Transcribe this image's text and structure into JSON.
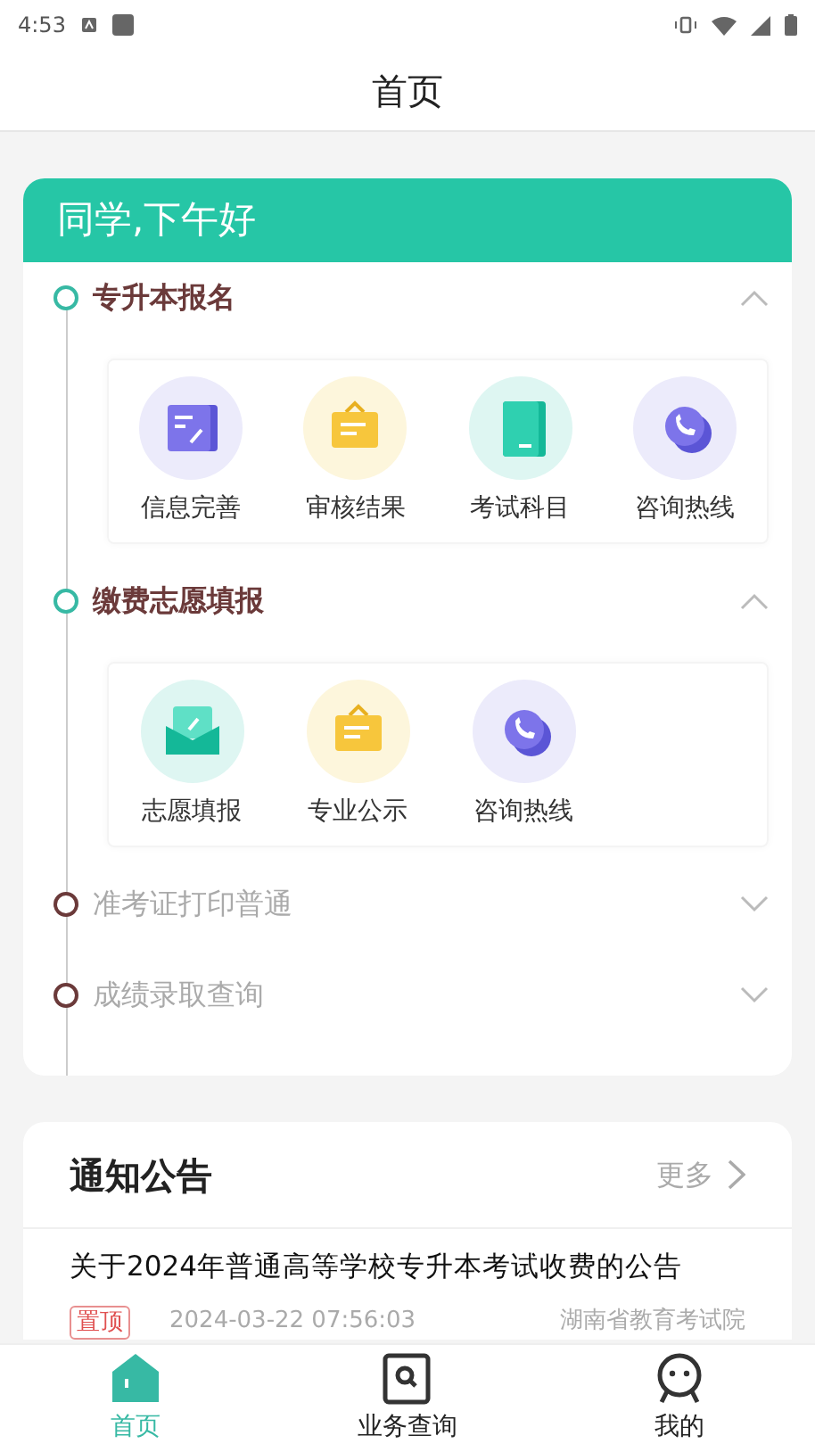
{
  "status_bar": {
    "time": "4:53"
  },
  "header": {
    "title": "首页"
  },
  "greeting": "同学,下午好",
  "sections": [
    {
      "title": "专升本报名",
      "expanded": true,
      "items": [
        {
          "label": "信息完善",
          "kind": "edit"
        },
        {
          "label": "审核结果",
          "kind": "notice"
        },
        {
          "label": "考试科目",
          "kind": "book"
        },
        {
          "label": "咨询热线",
          "kind": "phone"
        }
      ]
    },
    {
      "title": "缴费志愿填报",
      "expanded": true,
      "items": [
        {
          "label": "志愿填报",
          "kind": "mail"
        },
        {
          "label": "专业公示",
          "kind": "notice"
        },
        {
          "label": "咨询热线",
          "kind": "phone"
        }
      ]
    },
    {
      "title": "准考证打印普通",
      "expanded": false
    },
    {
      "title": "成绩录取查询",
      "expanded": false
    }
  ],
  "notices": {
    "title": "通知公告",
    "more": "更多",
    "items": [
      {
        "title": "关于2024年普通高等学校专升本考试收费的公告",
        "tag": "置顶",
        "date": "2024-03-22 07:56:03",
        "source": "湖南省教育考试院"
      }
    ]
  },
  "nav": [
    {
      "label": "首页",
      "kind": "home",
      "selected": true
    },
    {
      "label": "业务查询",
      "kind": "search",
      "selected": false
    },
    {
      "label": "我的",
      "kind": "me",
      "selected": false
    }
  ]
}
